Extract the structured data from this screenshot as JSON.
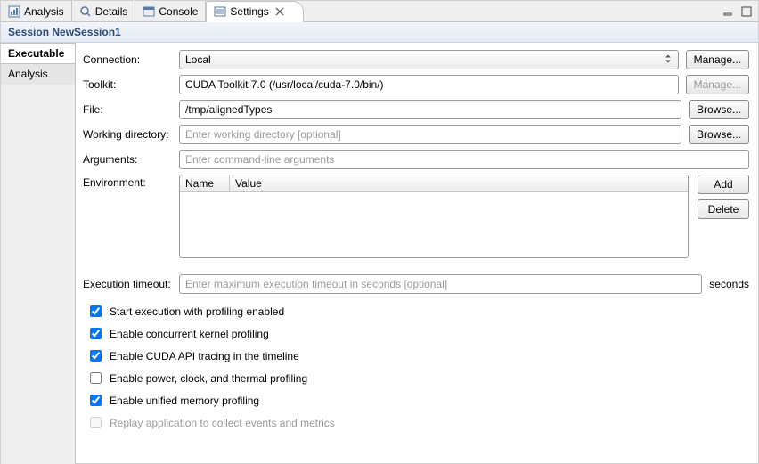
{
  "tabs": [
    {
      "label": "Analysis",
      "active": false
    },
    {
      "label": "Details",
      "active": false
    },
    {
      "label": "Console",
      "active": false
    },
    {
      "label": "Settings",
      "active": true
    }
  ],
  "title": "Session NewSession1",
  "sidebar": {
    "items": [
      {
        "label": "Executable",
        "active": true
      },
      {
        "label": "Analysis",
        "active": false
      }
    ]
  },
  "form": {
    "connection": {
      "label": "Connection:",
      "value": "Local",
      "manage": "Manage..."
    },
    "toolkit": {
      "label": "Toolkit:",
      "value": "CUDA Toolkit 7.0 (/usr/local/cuda-7.0/bin/)",
      "manage": "Manage..."
    },
    "file": {
      "label": "File:",
      "value": "/tmp/alignedTypes",
      "browse": "Browse..."
    },
    "workdir": {
      "label": "Working directory:",
      "placeholder": "Enter working directory [optional]",
      "browse": "Browse..."
    },
    "args": {
      "label": "Arguments:",
      "placeholder": "Enter command-line arguments"
    },
    "env": {
      "label": "Environment:",
      "columns": {
        "name": "Name",
        "value": "Value"
      },
      "add": "Add",
      "delete": "Delete"
    },
    "timeout": {
      "label": "Execution timeout:",
      "placeholder": "Enter maximum execution timeout in seconds [optional]",
      "suffix": "seconds"
    }
  },
  "checks": [
    {
      "label": "Start execution with profiling enabled",
      "checked": true,
      "disabled": false
    },
    {
      "label": "Enable concurrent kernel profiling",
      "checked": true,
      "disabled": false
    },
    {
      "label": "Enable CUDA API tracing in the timeline",
      "checked": true,
      "disabled": false
    },
    {
      "label": "Enable power, clock, and thermal profiling",
      "checked": false,
      "disabled": false
    },
    {
      "label": "Enable unified memory profiling",
      "checked": true,
      "disabled": false
    },
    {
      "label": "Replay application to collect events and metrics",
      "checked": false,
      "disabled": true
    }
  ]
}
